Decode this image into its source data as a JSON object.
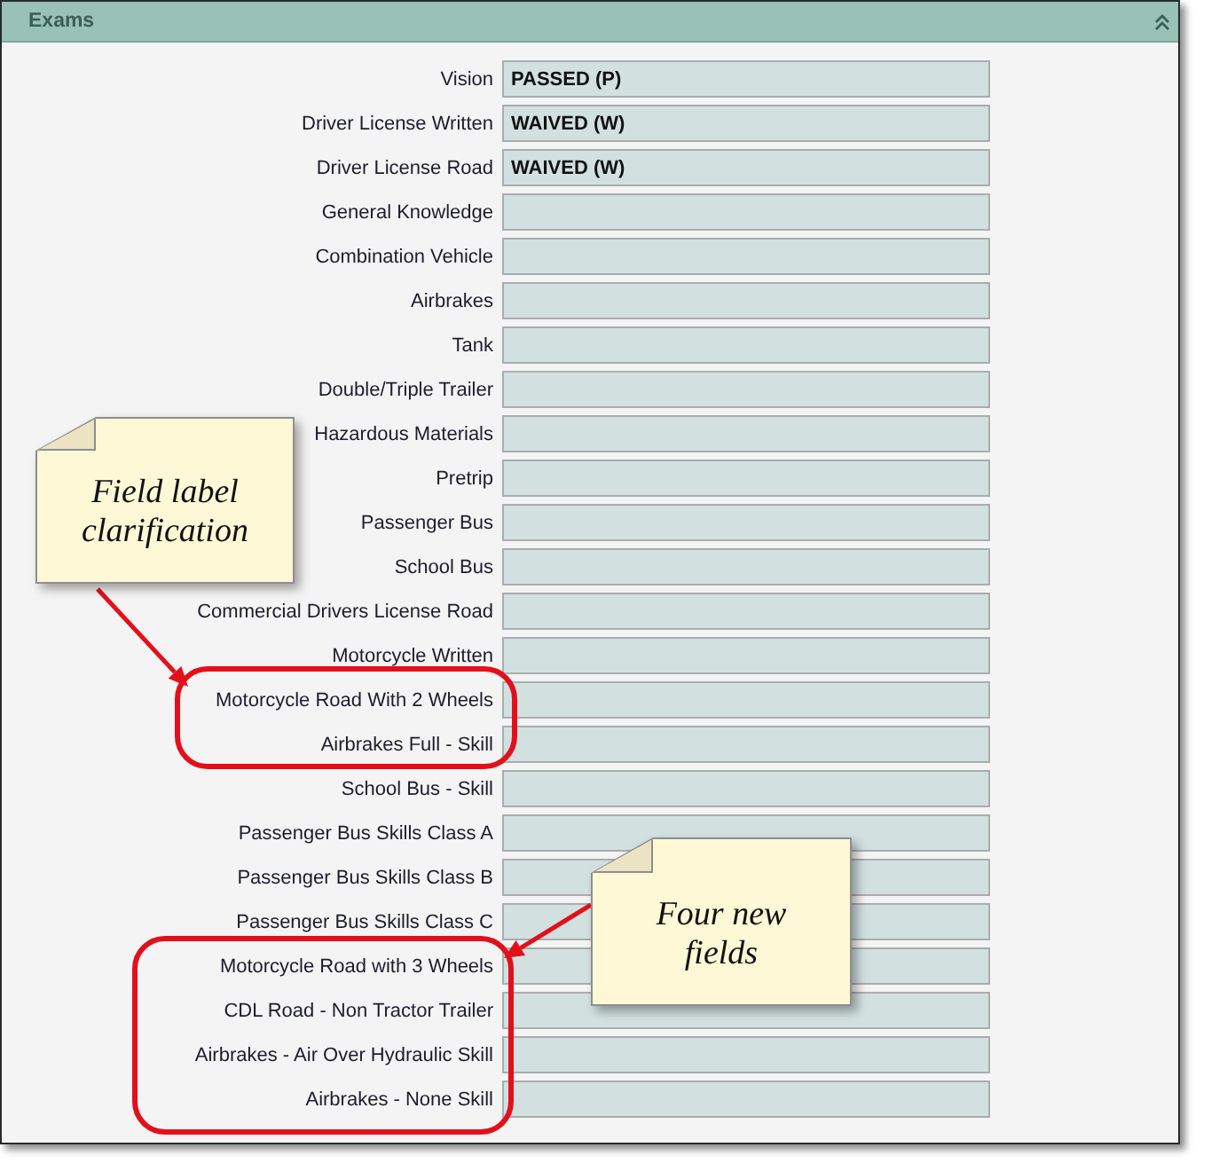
{
  "panel": {
    "title": "Exams"
  },
  "exams": [
    {
      "label": "Vision",
      "value": "PASSED (P)"
    },
    {
      "label": "Driver License Written",
      "value": "WAIVED (W)"
    },
    {
      "label": "Driver License Road",
      "value": "WAIVED (W)"
    },
    {
      "label": "General Knowledge"
    },
    {
      "label": "Combination Vehicle"
    },
    {
      "label": "Airbrakes"
    },
    {
      "label": "Tank"
    },
    {
      "label": "Double/Triple Trailer"
    },
    {
      "label": "Hazardous Materials"
    },
    {
      "label": "Pretrip"
    },
    {
      "label": "Passenger Bus"
    },
    {
      "label": "School Bus"
    },
    {
      "label": "Commercial Drivers License Road"
    },
    {
      "label": "Motorcycle Written"
    },
    {
      "label": "Motorcycle Road With 2 Wheels"
    },
    {
      "label": "Airbrakes Full - Skill"
    },
    {
      "label": "School Bus - Skill"
    },
    {
      "label": "Passenger Bus Skills Class A"
    },
    {
      "label": "Passenger Bus Skills Class B"
    },
    {
      "label": "Passenger Bus Skills Class C"
    },
    {
      "label": "Motorcycle Road with 3 Wheels"
    },
    {
      "label": "CDL Road - Non Tractor Trailer"
    },
    {
      "label": "Airbrakes - Air Over Hydraulic Skill"
    },
    {
      "label": "Airbrakes - None Skill"
    }
  ],
  "annotations": [
    {
      "text": "Field label clarification"
    },
    {
      "text": "Four new fields"
    }
  ]
}
